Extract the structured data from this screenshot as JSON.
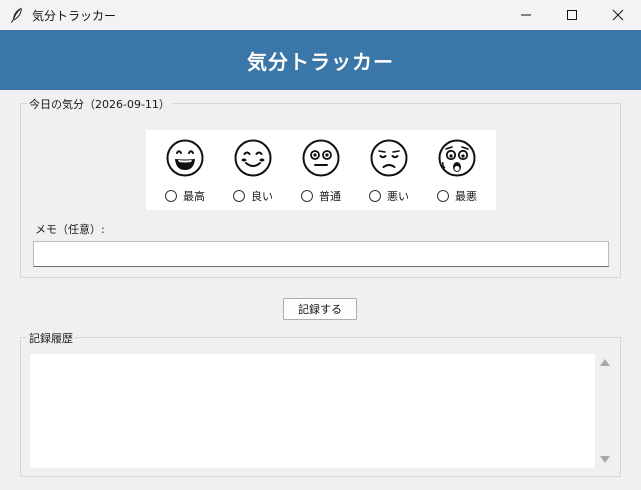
{
  "window": {
    "title": "気分トラッカー",
    "icon": "feather-icon"
  },
  "header": {
    "title": "気分トラッカー",
    "background": "#3a76a8"
  },
  "mood_section": {
    "label": "今日の気分（2026-09-11）",
    "options": [
      {
        "label": "最高",
        "icon": "grinning-face-icon",
        "selected": false
      },
      {
        "label": "良い",
        "icon": "smiling-face-icon",
        "selected": false
      },
      {
        "label": "普通",
        "icon": "neutral-face-icon",
        "selected": false
      },
      {
        "label": "悪い",
        "icon": "sad-face-icon",
        "selected": false
      },
      {
        "label": "最悪",
        "icon": "anguished-face-icon",
        "selected": false
      }
    ]
  },
  "memo": {
    "label": "メモ（任意）:",
    "value": "",
    "placeholder": ""
  },
  "actions": {
    "record_label": "記録する"
  },
  "history": {
    "label": "記録履歴",
    "entries": []
  }
}
